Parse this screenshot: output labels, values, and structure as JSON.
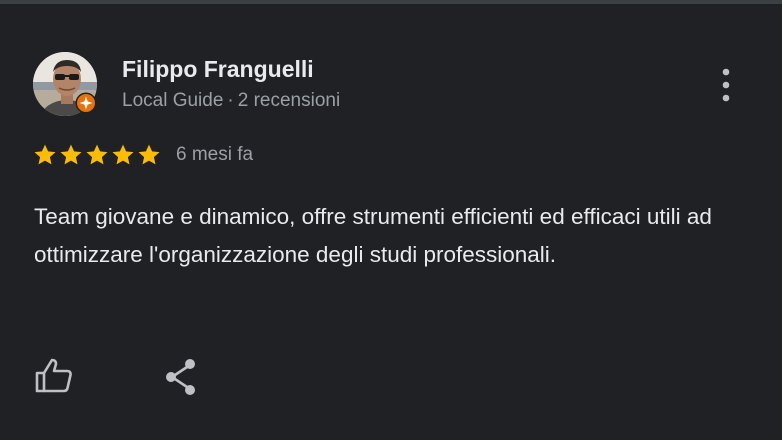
{
  "review": {
    "author_name": "Filippo Franguelli",
    "badge": "Local Guide",
    "separator": "·",
    "review_count": "2 recensioni",
    "rating": 5,
    "rating_max": 5,
    "date": "6 mesi fa",
    "text": "Team giovane e dinamico, offre strumenti efficienti ed efficaci utili ad ottimizzare l'organizzazione degli studi professionali."
  },
  "icons": {
    "avatar": "user-photo-avatar",
    "badge": "local-guide-badge-icon",
    "more": "more-vert-icon",
    "star": "star-icon",
    "like": "thumb-up-icon",
    "share": "share-icon"
  },
  "colors": {
    "background": "#202124",
    "star": "#fbbc04",
    "badge": "#e8710a",
    "text_primary": "#e8eaed",
    "text_secondary": "#9aa0a6"
  }
}
